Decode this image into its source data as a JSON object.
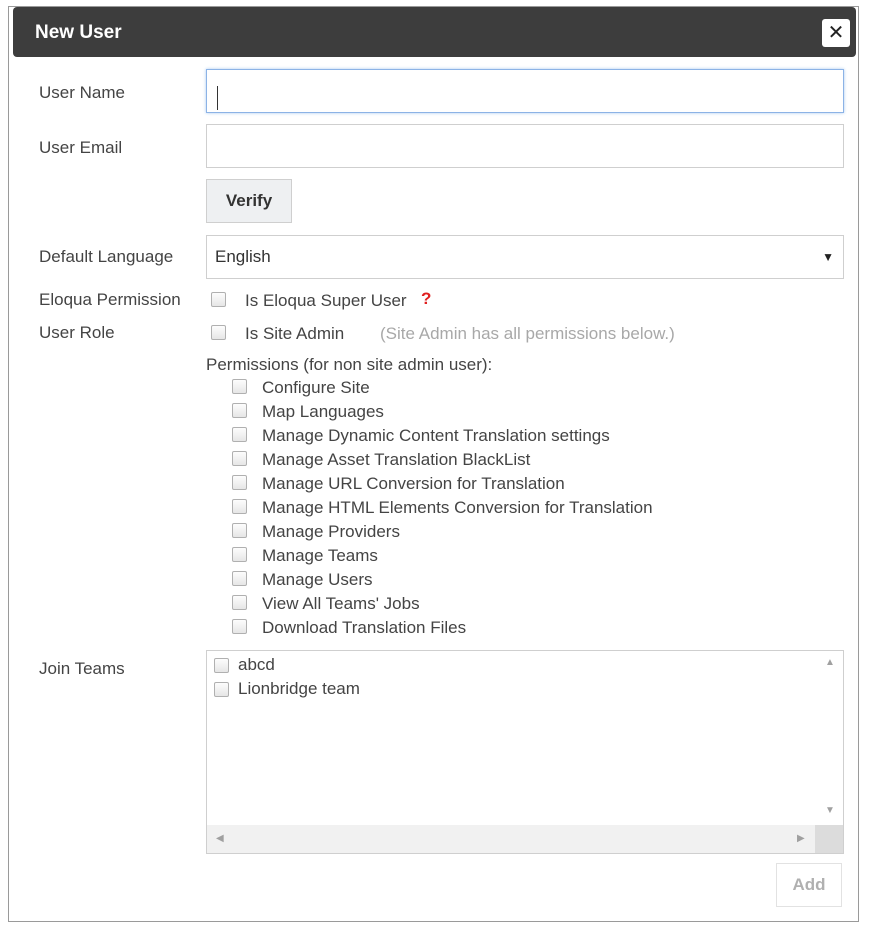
{
  "dialog": {
    "title": "New User",
    "close_icon": "close-icon"
  },
  "form": {
    "user_name": {
      "label": "User Name",
      "value": "",
      "placeholder": ""
    },
    "user_email": {
      "label": "User Email",
      "value": "",
      "placeholder": ""
    },
    "verify_label": "Verify",
    "default_language": {
      "label": "Default Language",
      "selected": "English"
    },
    "eloqua_permission": {
      "label": "Eloqua Permission",
      "checkbox_label": "Is Eloqua Super User",
      "help_text": "?"
    },
    "user_role": {
      "label": "User Role",
      "checkbox_label": "Is Site Admin",
      "note": "(Site Admin has all permissions below.)"
    },
    "permissions": {
      "heading": "Permissions (for non site admin user):",
      "items": [
        "Configure Site",
        "Map Languages",
        "Manage Dynamic Content Translation settings",
        "Manage Asset Translation BlackList",
        "Manage URL Conversion for Translation",
        "Manage HTML Elements Conversion for Translation",
        "Manage Providers",
        "Manage Teams",
        "Manage Users",
        "View All Teams' Jobs",
        "Download Translation Files"
      ]
    },
    "join_teams": {
      "label": "Join Teams",
      "teams": [
        "abcd",
        "Lionbridge team"
      ]
    },
    "add_label": "Add"
  },
  "colors": {
    "titlebar": "#3d3d3d",
    "help": "#e02020",
    "focus_border": "#8cb3e6"
  }
}
